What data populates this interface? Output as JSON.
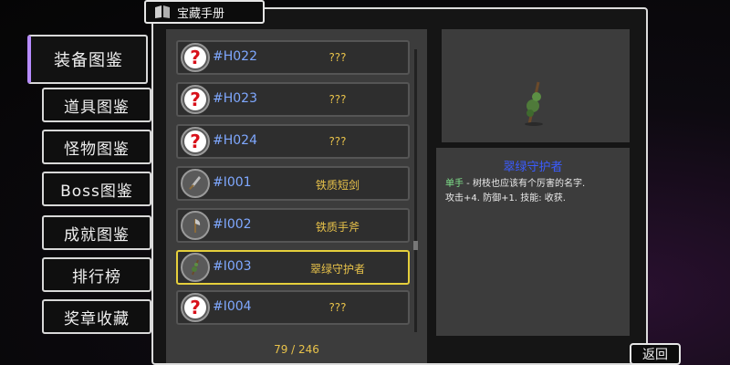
{
  "header": {
    "title": "宝藏手册",
    "icon": "book-icon"
  },
  "nav": {
    "items": [
      {
        "label": "装备图鉴",
        "active": true
      },
      {
        "label": "道具图鉴",
        "active": false
      },
      {
        "label": "怪物图鉴",
        "active": false
      },
      {
        "label": "Boss图鉴",
        "active": false
      },
      {
        "label": "成就图鉴",
        "active": false
      },
      {
        "label": "排行榜",
        "active": false
      },
      {
        "label": "奖章收藏",
        "active": false
      }
    ]
  },
  "list": {
    "rows": [
      {
        "id": "#H022",
        "name": "???",
        "icon": "question-mark-icon",
        "selected": false
      },
      {
        "id": "#H023",
        "name": "???",
        "icon": "question-mark-icon",
        "selected": false
      },
      {
        "id": "#H024",
        "name": "???",
        "icon": "question-mark-icon",
        "selected": false
      },
      {
        "id": "#I001",
        "name": "铁质短剑",
        "icon": "sword-icon",
        "selected": false
      },
      {
        "id": "#I002",
        "name": "铁质手斧",
        "icon": "axe-icon",
        "selected": false
      },
      {
        "id": "#I003",
        "name": "翠绿守护者",
        "icon": "branch-weapon-icon",
        "selected": true
      },
      {
        "id": "#I004",
        "name": "???",
        "icon": "question-mark-icon",
        "selected": false
      }
    ],
    "count": "79 / 246"
  },
  "detail": {
    "title": "翠绿守护者",
    "type": "单手",
    "line1": " - 树枝也应该有个厉害的名字.",
    "line2": "攻击+4. 防御+1. 技能: 收获.",
    "preview_icon": "branch-weapon-icon"
  },
  "footer": {
    "back_label": "返回"
  },
  "colors": {
    "accent_gold": "#e8c24a",
    "id_blue": "#7fa8ff",
    "title_blue": "#3b5cff",
    "type_green": "#7fe08a",
    "selected_border": "#e5cf3c",
    "nav_active_border": "#b78cff"
  }
}
